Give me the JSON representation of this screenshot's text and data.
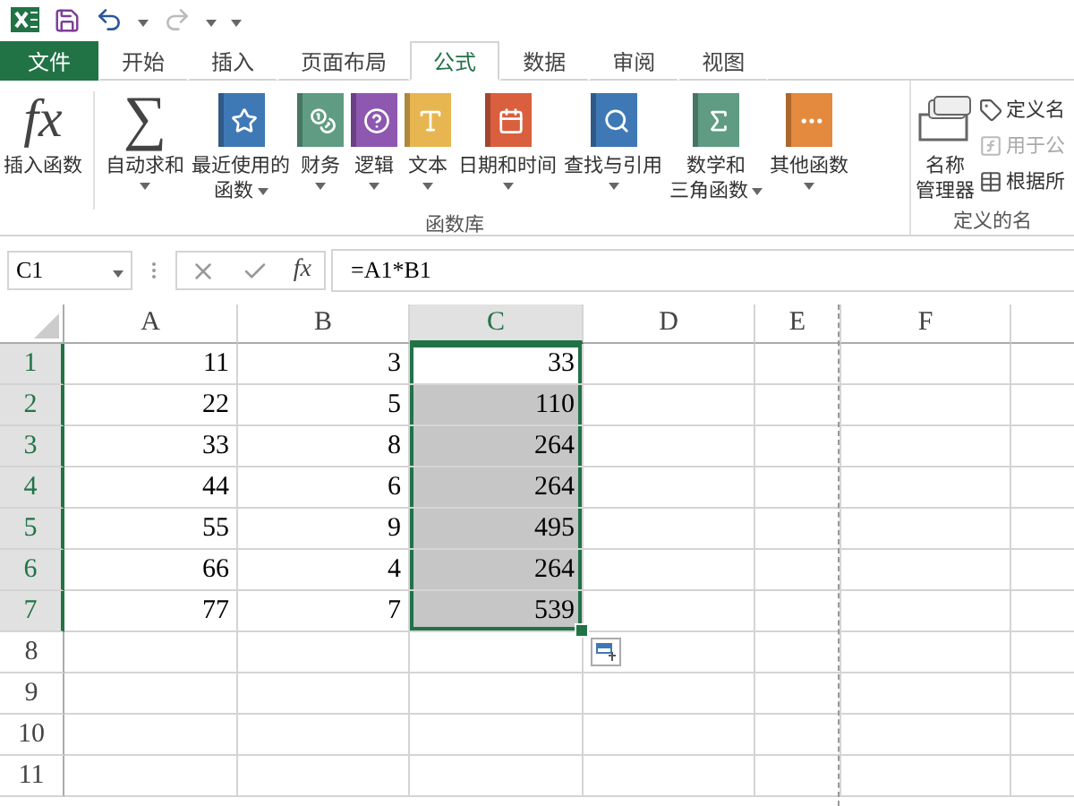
{
  "tabs": [
    {
      "label": "文件",
      "kind": "file",
      "selected": false
    },
    {
      "label": "开始",
      "kind": "tab",
      "selected": false
    },
    {
      "label": "插入",
      "kind": "tab",
      "selected": false
    },
    {
      "label": "页面布局",
      "kind": "tab",
      "selected": false
    },
    {
      "label": "公式",
      "kind": "tab",
      "selected": true
    },
    {
      "label": "数据",
      "kind": "tab",
      "selected": false
    },
    {
      "label": "审阅",
      "kind": "tab",
      "selected": false
    },
    {
      "label": "视图",
      "kind": "tab",
      "selected": false
    }
  ],
  "ribbon": {
    "groups": [
      {
        "label": "函数库",
        "buttons": [
          {
            "lines": [
              "插入函数"
            ],
            "symbol": "fx",
            "dropdown": false
          },
          {
            "lines": [
              "自动求和"
            ],
            "symbol": "∑",
            "dropdown": true
          },
          {
            "lines": [
              "最近使用的",
              "函数"
            ],
            "dropdown": true
          },
          {
            "lines": [
              "财务"
            ],
            "dropdown": true
          },
          {
            "lines": [
              "逻辑"
            ],
            "dropdown": true
          },
          {
            "lines": [
              "文本"
            ],
            "dropdown": true
          },
          {
            "lines": [
              "日期和时间"
            ],
            "dropdown": true
          },
          {
            "lines": [
              "查找与引用"
            ],
            "dropdown": true
          },
          {
            "lines": [
              "数学和",
              "三角函数"
            ],
            "dropdown": true
          },
          {
            "lines": [
              "其他函数"
            ],
            "dropdown": true
          }
        ]
      },
      {
        "label": "定义的名",
        "buttons": [
          {
            "lines": [
              "名称",
              "管理器"
            ],
            "dropdown": false
          }
        ],
        "small_buttons": [
          {
            "label": "定义名",
            "disabled": false
          },
          {
            "label": "用于公",
            "disabled": true
          },
          {
            "label": "根据所",
            "disabled": false
          }
        ]
      }
    ]
  },
  "formula_bar": {
    "name_box": "C1",
    "fx_symbol": "fx",
    "formula": "=A1*B1"
  },
  "sheet": {
    "columns": [
      {
        "label": "A",
        "selected": false
      },
      {
        "label": "B",
        "selected": false
      },
      {
        "label": "C",
        "selected": true
      },
      {
        "label": "D",
        "selected": false
      },
      {
        "label": "E",
        "selected": false
      },
      {
        "label": "F",
        "selected": false
      }
    ],
    "rows": [
      {
        "header": "1",
        "selected": true,
        "cells": [
          {
            "value": "11",
            "selected": false,
            "active": false
          },
          {
            "value": "3",
            "selected": false,
            "active": false
          },
          {
            "value": "33",
            "selected": true,
            "active": true
          }
        ]
      },
      {
        "header": "2",
        "selected": true,
        "cells": [
          {
            "value": "22",
            "selected": false,
            "active": false
          },
          {
            "value": "5",
            "selected": false,
            "active": false
          },
          {
            "value": "110",
            "selected": true,
            "active": false
          }
        ]
      },
      {
        "header": "3",
        "selected": true,
        "cells": [
          {
            "value": "33",
            "selected": false,
            "active": false
          },
          {
            "value": "8",
            "selected": false,
            "active": false
          },
          {
            "value": "264",
            "selected": true,
            "active": false
          }
        ]
      },
      {
        "header": "4",
        "selected": true,
        "cells": [
          {
            "value": "44",
            "selected": false,
            "active": false
          },
          {
            "value": "6",
            "selected": false,
            "active": false
          },
          {
            "value": "264",
            "selected": true,
            "active": false
          }
        ]
      },
      {
        "header": "5",
        "selected": true,
        "cells": [
          {
            "value": "55",
            "selected": false,
            "active": false
          },
          {
            "value": "9",
            "selected": false,
            "active": false
          },
          {
            "value": "495",
            "selected": true,
            "active": false
          }
        ]
      },
      {
        "header": "6",
        "selected": true,
        "cells": [
          {
            "value": "66",
            "selected": false,
            "active": false
          },
          {
            "value": "4",
            "selected": false,
            "active": false
          },
          {
            "value": "264",
            "selected": true,
            "active": false
          }
        ]
      },
      {
        "header": "7",
        "selected": true,
        "cells": [
          {
            "value": "77",
            "selected": false,
            "active": false
          },
          {
            "value": "7",
            "selected": false,
            "active": false
          },
          {
            "value": "539",
            "selected": true,
            "active": false
          }
        ]
      },
      {
        "header": "8",
        "selected": false
      },
      {
        "header": "9",
        "selected": false
      },
      {
        "header": "10",
        "selected": false
      },
      {
        "header": "11",
        "selected": false
      }
    ]
  }
}
